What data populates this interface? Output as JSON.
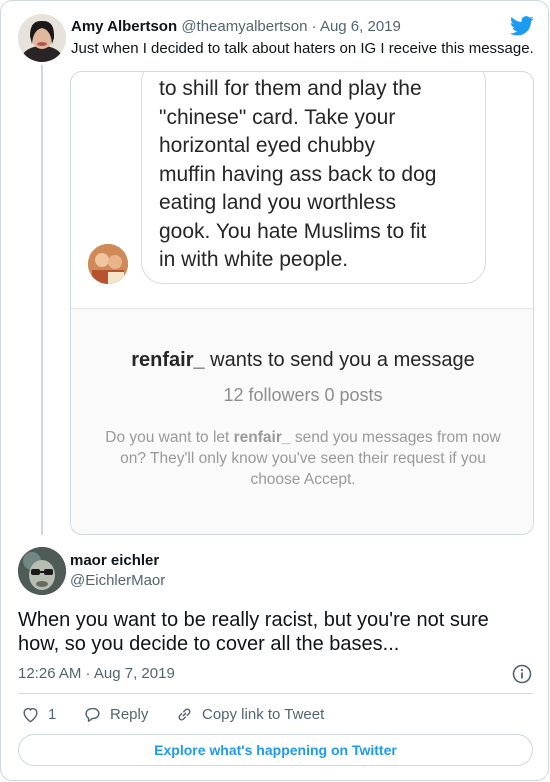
{
  "parent_tweet": {
    "author_name": "Amy Albertson",
    "handle": "@theamyalbertson",
    "separator": " · ",
    "date": "Aug 6, 2019",
    "text": "Just when I decided to talk about haters on IG I receive this message.",
    "media": {
      "message_text": "to shill for them and play the\n\"chinese\" card. Take your\nhorizontal eyed chubby\nmuffin having ass back to dog\neating land you worthless\ngook. You hate Muslims to fit\nin with white people.",
      "request_user": "renfair_",
      "request_title_suffix": " wants to send you a message",
      "request_stats": "12 followers 0 posts",
      "request_body_prefix": "Do you want to let ",
      "request_body_suffix": " send you messages from now on? They'll only know you've seen their request if you choose Accept."
    }
  },
  "main_tweet": {
    "author_name": "maor eichler",
    "handle": "@EichlerMaor",
    "text": "When you want to be really racist, but you're not sure how, so you decide to cover all the bases...",
    "timestamp": "12:26 AM · Aug 7, 2019"
  },
  "actions": {
    "like_count": "1",
    "reply_label": "Reply",
    "copy_link_label": "Copy link to Tweet"
  },
  "explore_label": "Explore what's happening on Twitter",
  "icons": {
    "brand": "twitter-bird-icon",
    "like": "heart-icon",
    "reply": "speech-bubble-icon",
    "copy": "link-icon",
    "info": "info-icon"
  },
  "colors": {
    "accent": "#1d9bf0",
    "secondary_text": "#536471",
    "border": "#cfd9de"
  }
}
